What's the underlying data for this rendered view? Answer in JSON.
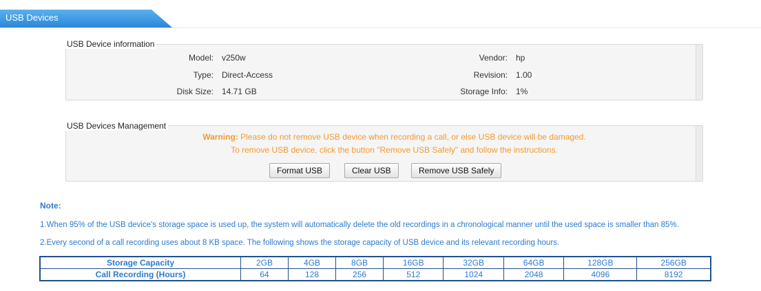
{
  "tab": {
    "label": "USB Devices"
  },
  "info": {
    "legend": "USB Device information",
    "model_label": "Model:",
    "model_value": "v250w",
    "type_label": "Type:",
    "type_value": "Direct-Access",
    "disk_label": "Disk Size:",
    "disk_value": "14.71 GB",
    "vendor_label": "Vendor:",
    "vendor_value": "hp",
    "revision_label": "Revision:",
    "revision_value": "1.00",
    "storage_label": "Storage Info:",
    "storage_value": "1%"
  },
  "management": {
    "legend": "USB Devices Management",
    "warning_prefix": "Warning:",
    "warning_text": " Please do not remove USB device when recording a call, or else USB device will be damaged.",
    "instruction": "To remove USB device, click the button \"Remove USB Safely\" and follow the instructions.",
    "format_button": "Format USB",
    "clear_button": "Clear USB",
    "remove_button": "Remove USB Safely"
  },
  "note": {
    "title": "Note:",
    "line1": "1.When 95% of the USB device's storage space is used up, the system will automatically delete the old recordings in a chronological manner until the used space is smaller than 85%.",
    "line2": "2.Every second of a call recording uses about 8 KB space. The following shows the storage capacity of USB device and its relevant recording hours."
  },
  "table": {
    "row1_header": "Storage Capacity",
    "row1": [
      "2GB",
      "4GB",
      "8GB",
      "16GB",
      "32GB",
      "64GB",
      "128GB",
      "256GB"
    ],
    "row2_header": "Call Recording (Hours)",
    "row2": [
      "64",
      "128",
      "256",
      "512",
      "1024",
      "2048",
      "4096",
      "8192"
    ]
  }
}
